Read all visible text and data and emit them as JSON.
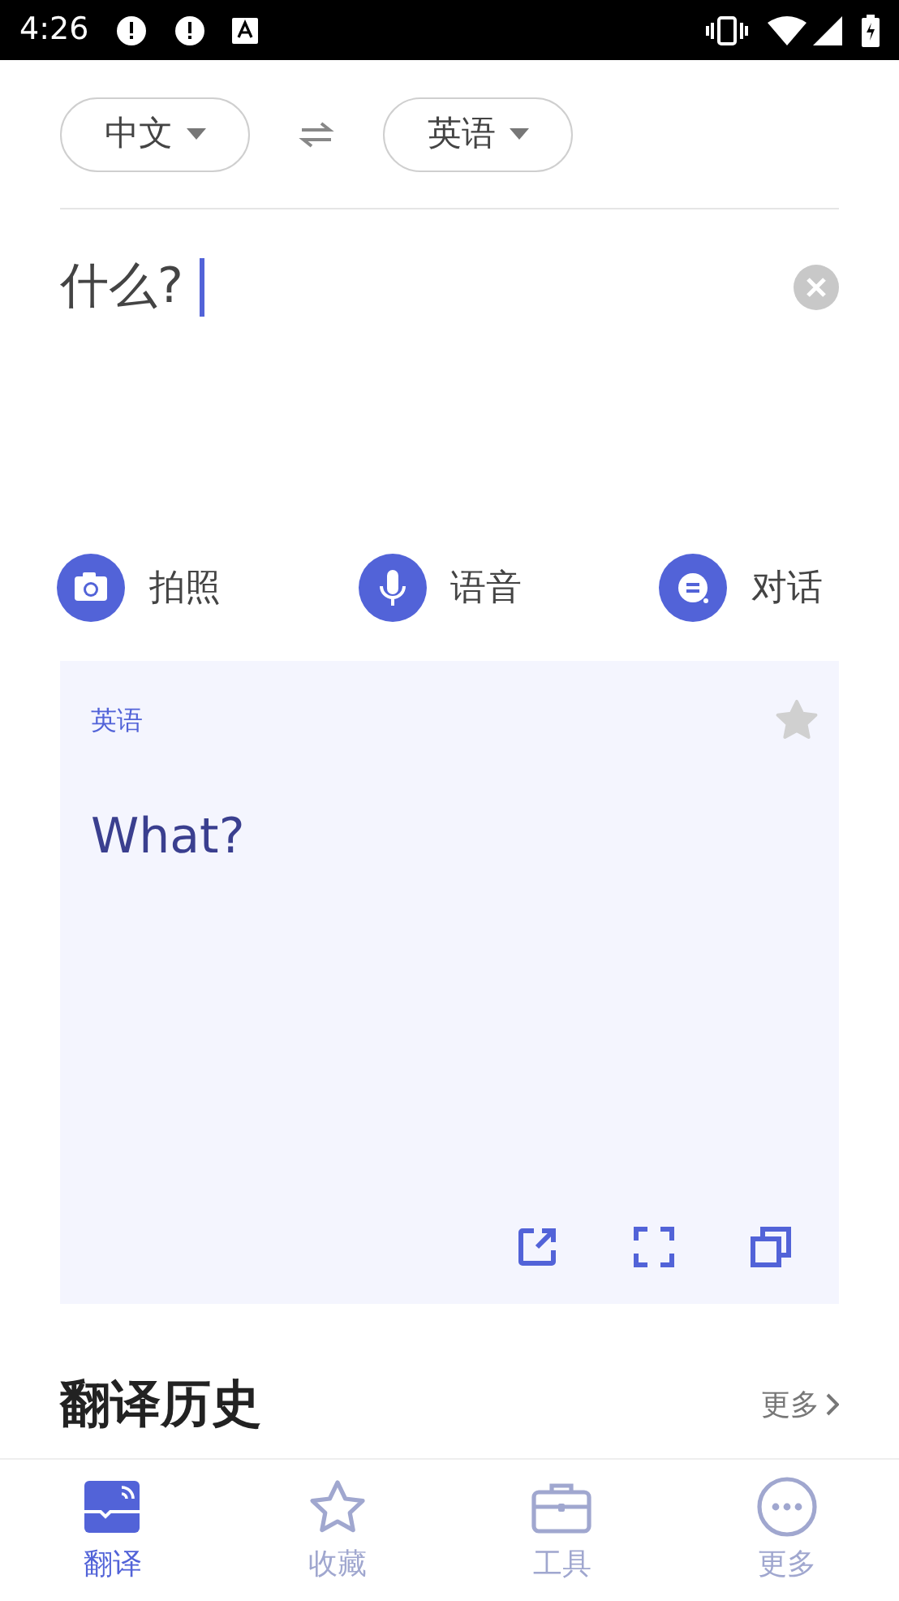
{
  "status_bar": {
    "time": "4:26"
  },
  "languages": {
    "source": "中文",
    "target": "英语"
  },
  "input": {
    "value": "什么?"
  },
  "actions": [
    {
      "kind": "camera",
      "label": "拍照"
    },
    {
      "kind": "voice",
      "label": "语音"
    },
    {
      "kind": "dialog",
      "label": "对话"
    }
  ],
  "result": {
    "language": "英语",
    "text": "What?",
    "favorited": false
  },
  "history": {
    "title": "翻译历史",
    "more": "更多"
  },
  "tabs": [
    {
      "kind": "translate",
      "label": "翻译",
      "selected": true
    },
    {
      "kind": "favorites",
      "label": "收藏",
      "selected": false
    },
    {
      "kind": "tools",
      "label": "工具",
      "selected": false
    },
    {
      "kind": "more",
      "label": "更多",
      "selected": false
    }
  ]
}
